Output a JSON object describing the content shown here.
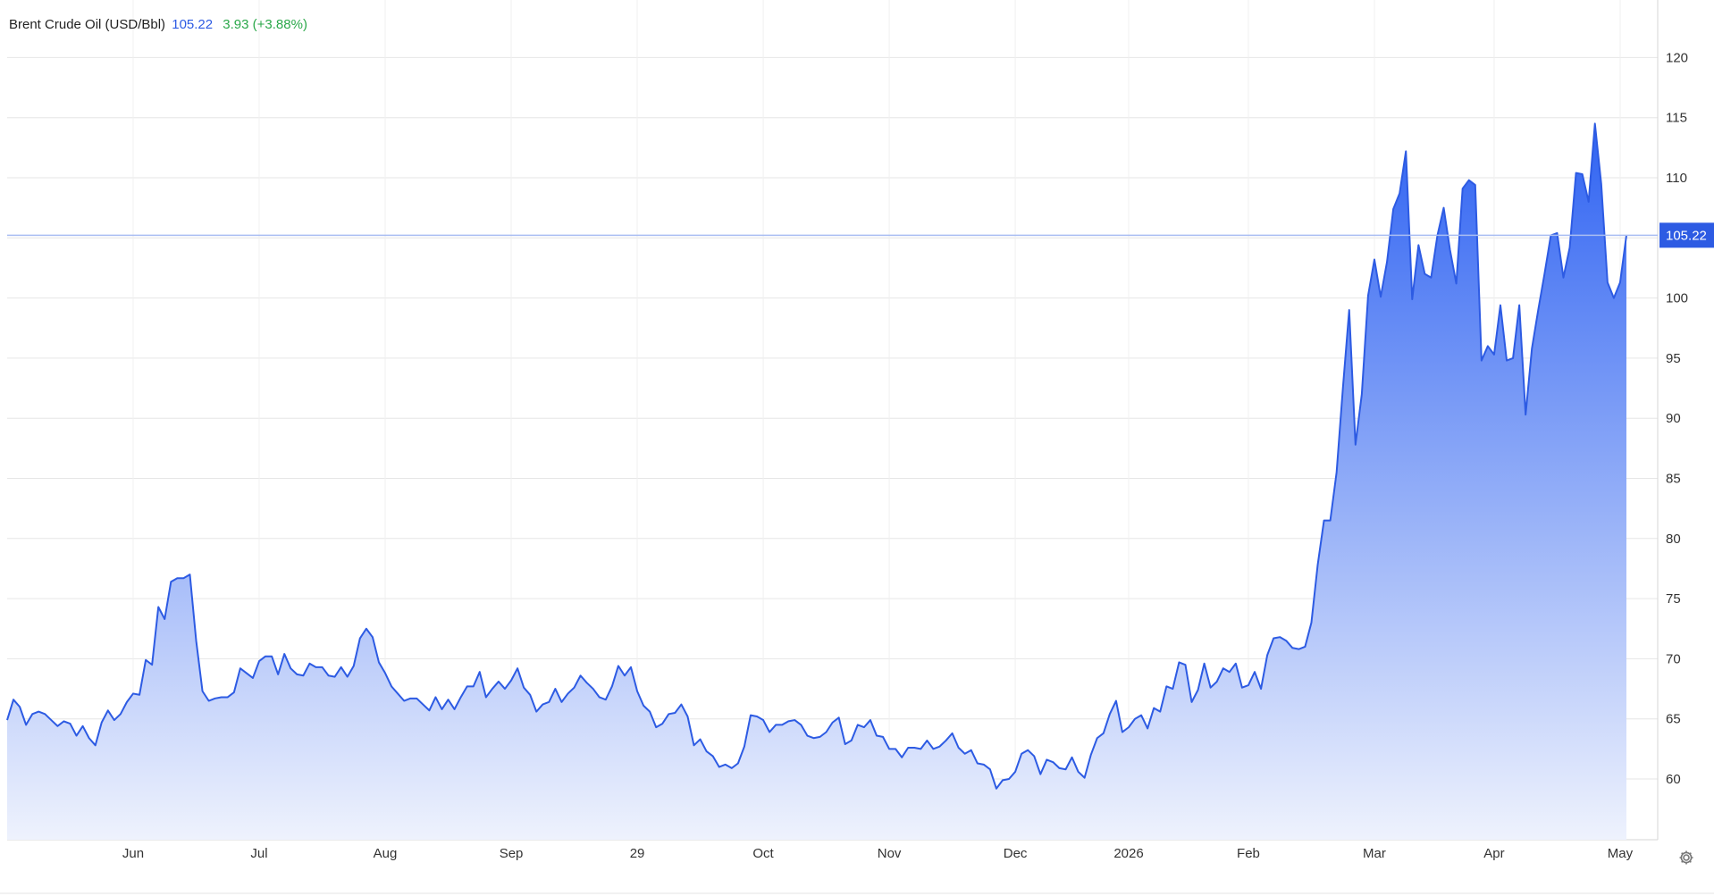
{
  "legend": {
    "name": "Brent Crude Oil (USD/Bbl)",
    "price": "105.22",
    "change": "3.93 (+3.88%)"
  },
  "colors": {
    "line": "#2d5be3",
    "fill_top": "#2f63f2",
    "fill_bottom": "#eef2fd",
    "price_badge": "#2d5be3",
    "change_positive": "#2ba84a",
    "grid": "#e6e6e6"
  },
  "settings": {
    "icon": "gear-icon"
  },
  "chart_data": {
    "type": "area",
    "title": "Brent Crude Oil (USD/Bbl)",
    "xlabel": "",
    "ylabel": "",
    "ylim": [
      55,
      124
    ],
    "y_ticks": [
      60,
      65,
      70,
      75,
      80,
      85,
      90,
      95,
      100,
      105,
      110,
      115,
      120
    ],
    "grid": true,
    "legend_placement": "top-left",
    "last_value_label": "105.22",
    "x_tick_labels": [
      "Jun",
      "Jul",
      "Aug",
      "Sep",
      "29",
      "Oct",
      "Nov",
      "Dec",
      "2026",
      "Feb",
      "Mar",
      "Apr",
      "May"
    ],
    "x_tick_index": [
      20,
      40,
      60,
      80,
      100,
      120,
      140,
      160,
      178,
      197,
      217,
      236,
      256
    ],
    "series": [
      {
        "values": [
          64.9,
          66.6,
          66.0,
          64.5,
          65.4,
          65.6,
          65.4,
          64.9,
          64.4,
          64.8,
          64.6,
          63.6,
          64.4,
          63.4,
          62.8,
          64.7,
          65.7,
          64.9,
          65.4,
          66.4,
          67.1,
          67.0,
          69.9,
          69.5,
          74.3,
          73.3,
          76.4,
          76.7,
          76.7,
          77.0,
          71.5,
          67.3,
          66.5,
          66.7,
          66.8,
          66.8,
          67.2,
          69.2,
          68.8,
          68.4,
          69.8,
          70.2,
          70.2,
          68.7,
          70.4,
          69.2,
          68.7,
          68.6,
          69.6,
          69.3,
          69.3,
          68.6,
          68.5,
          69.3,
          68.5,
          69.4,
          71.7,
          72.5,
          71.8,
          69.7,
          68.8,
          67.7,
          67.1,
          66.5,
          66.7,
          66.7,
          66.2,
          65.7,
          66.8,
          65.8,
          66.6,
          65.8,
          66.8,
          67.7,
          67.7,
          68.9,
          66.8,
          67.5,
          68.1,
          67.5,
          68.2,
          69.2,
          67.6,
          67.0,
          65.6,
          66.2,
          66.4,
          67.5,
          66.4,
          67.1,
          67.6,
          68.6,
          68.0,
          67.5,
          66.8,
          66.6,
          67.7,
          69.4,
          68.6,
          69.3,
          67.3,
          66.1,
          65.6,
          64.3,
          64.6,
          65.4,
          65.5,
          66.2,
          65.2,
          62.8,
          63.3,
          62.3,
          61.9,
          61.0,
          61.2,
          60.9,
          61.3,
          62.7,
          65.3,
          65.2,
          64.9,
          63.9,
          64.5,
          64.5,
          64.8,
          64.9,
          64.5,
          63.6,
          63.4,
          63.5,
          63.9,
          64.7,
          65.1,
          62.9,
          63.2,
          64.5,
          64.3,
          64.9,
          63.6,
          63.5,
          62.5,
          62.5,
          61.8,
          62.6,
          62.6,
          62.5,
          63.2,
          62.5,
          62.7,
          63.2,
          63.8,
          62.6,
          62.1,
          62.4,
          61.3,
          61.2,
          60.8,
          59.2,
          59.9,
          60.0,
          60.6,
          62.1,
          62.4,
          61.9,
          60.4,
          61.6,
          61.4,
          60.9,
          60.8,
          61.8,
          60.6,
          60.1,
          62.0,
          63.4,
          63.8,
          65.4,
          66.5,
          63.9,
          64.3,
          65.0,
          65.3,
          64.2,
          65.9,
          65.6,
          67.7,
          67.5,
          69.7,
          69.5,
          66.4,
          67.4,
          69.6,
          67.6,
          68.1,
          69.2,
          68.9,
          69.6,
          67.6,
          67.8,
          68.9,
          67.5,
          70.3,
          71.7,
          71.8,
          71.5,
          70.9,
          70.8,
          71.0,
          73.0,
          77.8,
          81.5,
          81.5,
          85.5,
          92.5,
          99.0,
          87.8,
          92.0,
          100.2,
          103.2,
          100.1,
          103.0,
          107.4,
          108.7,
          112.2,
          99.9,
          104.4,
          102.0,
          101.7,
          105.2,
          107.5,
          104.0,
          101.2,
          109.1,
          109.8,
          109.4,
          94.8,
          96.0,
          95.3,
          99.4,
          94.8,
          95.0,
          99.4,
          90.3,
          95.8,
          99.0,
          102.0,
          105.2,
          105.4,
          101.7,
          104.2,
          110.4,
          110.3,
          108.0,
          114.5,
          109.5,
          101.3,
          100.0,
          101.3,
          105.22
        ]
      }
    ]
  }
}
